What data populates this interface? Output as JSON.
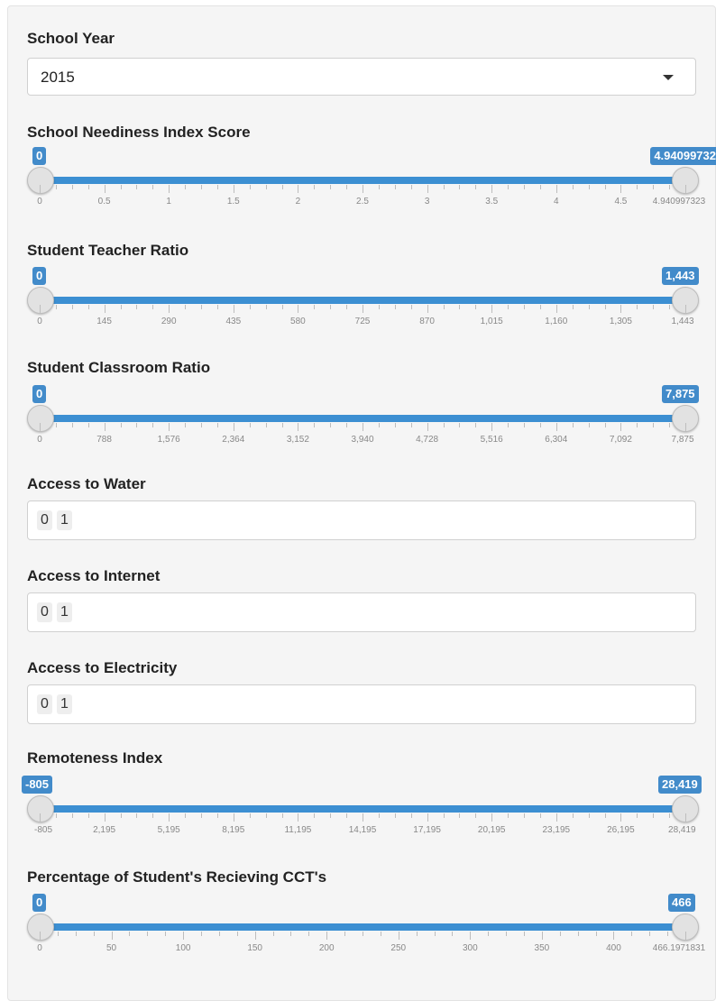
{
  "school_year": {
    "label": "School Year",
    "value": "2015"
  },
  "sliders": [
    {
      "key": "needy",
      "label": "School Neediness Index Score",
      "min_badge": "0",
      "max_badge": "4.94099732",
      "ticks": [
        "0",
        "0.5",
        "1",
        "1.5",
        "2",
        "2.5",
        "3",
        "3.5",
        "4",
        "4.5",
        "4.940997323"
      ]
    },
    {
      "key": "str",
      "label": "Student Teacher Ratio",
      "min_badge": "0",
      "max_badge": "1,443",
      "ticks": [
        "0",
        "145",
        "290",
        "435",
        "580",
        "725",
        "870",
        "1,015",
        "1,160",
        "1,305",
        "1,443"
      ]
    },
    {
      "key": "scr",
      "label": "Student Classroom Ratio",
      "min_badge": "0",
      "max_badge": "7,875",
      "ticks": [
        "0",
        "788",
        "1,576",
        "2,364",
        "3,152",
        "3,940",
        "4,728",
        "5,516",
        "6,304",
        "7,092",
        "7,875"
      ]
    },
    {
      "key": "remote",
      "label": "Remoteness Index",
      "min_badge": "-805",
      "max_badge": "28,419",
      "ticks": [
        "-805",
        "2,195",
        "5,195",
        "8,195",
        "11,195",
        "14,195",
        "17,195",
        "20,195",
        "23,195",
        "26,195",
        "28,419"
      ]
    },
    {
      "key": "cct",
      "label": "Percentage of Student's Recieving CCT's",
      "min_badge": "0",
      "max_badge": "466",
      "ticks": [
        "0",
        "50",
        "100",
        "150",
        "200",
        "250",
        "300",
        "350",
        "400",
        "466.1971831"
      ]
    }
  ],
  "water": {
    "label": "Access to Water",
    "chips": [
      "0",
      "1"
    ]
  },
  "internet": {
    "label": "Access to Internet",
    "chips": [
      "0",
      "1"
    ]
  },
  "electricity": {
    "label": "Access to Electricity",
    "chips": [
      "0",
      "1"
    ]
  }
}
